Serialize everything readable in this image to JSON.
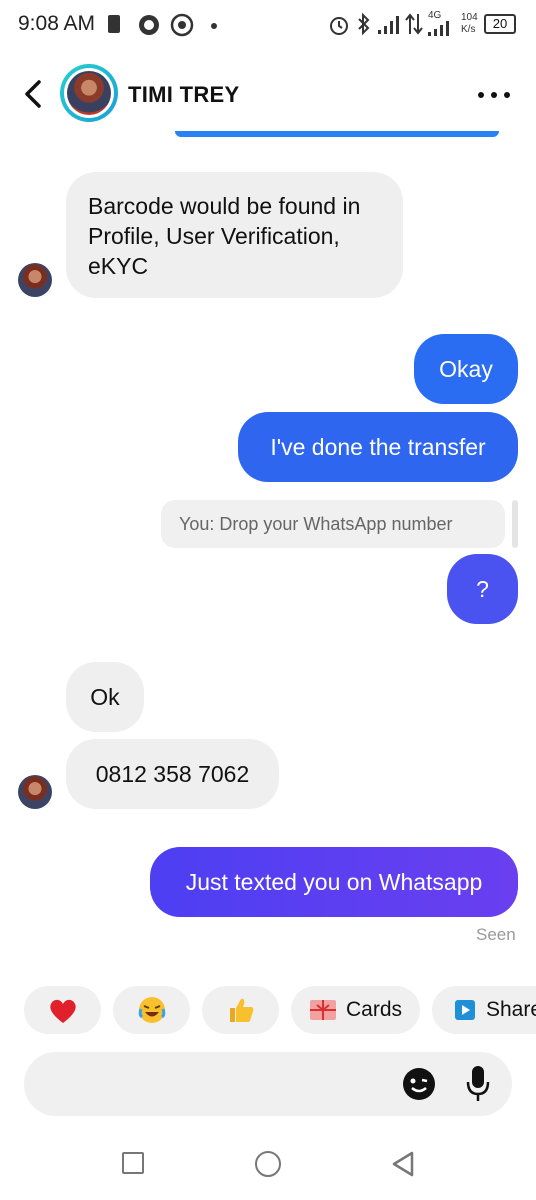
{
  "status_bar": {
    "time": "9:08 AM",
    "network": "4G",
    "speed_value": "104",
    "speed_unit": "K/s",
    "battery": "20"
  },
  "header": {
    "contact_name": "TIMI TREY"
  },
  "messages": [
    {
      "sender": "them",
      "text": "Barcode would be found in Profile, User Verification, eKYC",
      "lines": [
        "Barcode would be found in",
        "Profile, User Verification,",
        "eKYC"
      ]
    },
    {
      "sender": "me",
      "text": "Okay"
    },
    {
      "sender": "me",
      "text": "I've done the transfer"
    },
    {
      "sender": "me",
      "reply_preview": "You: Drop your WhatsApp number",
      "text": "?"
    },
    {
      "sender": "them",
      "text": "Ok"
    },
    {
      "sender": "them",
      "text": "0812 358 7062"
    },
    {
      "sender": "me",
      "text": "Just texted you on Whatsapp"
    }
  ],
  "seen_label": "Seen",
  "quick_replies": [
    {
      "icon": "heart-icon",
      "label": ""
    },
    {
      "icon": "laughing-emoji-icon",
      "label": ""
    },
    {
      "icon": "thumbs-up-icon",
      "label": ""
    },
    {
      "icon": "cards-icon",
      "label": "Cards"
    },
    {
      "icon": "share-icon",
      "label": "Share"
    }
  ],
  "composer": {
    "placeholder": ""
  },
  "colors": {
    "bubble_in": "#efefef",
    "bubble_out_blue": "#2f6bf0",
    "bubble_out_purple": "#6b3ff0",
    "avatar_ring": "#1fb9d4"
  }
}
